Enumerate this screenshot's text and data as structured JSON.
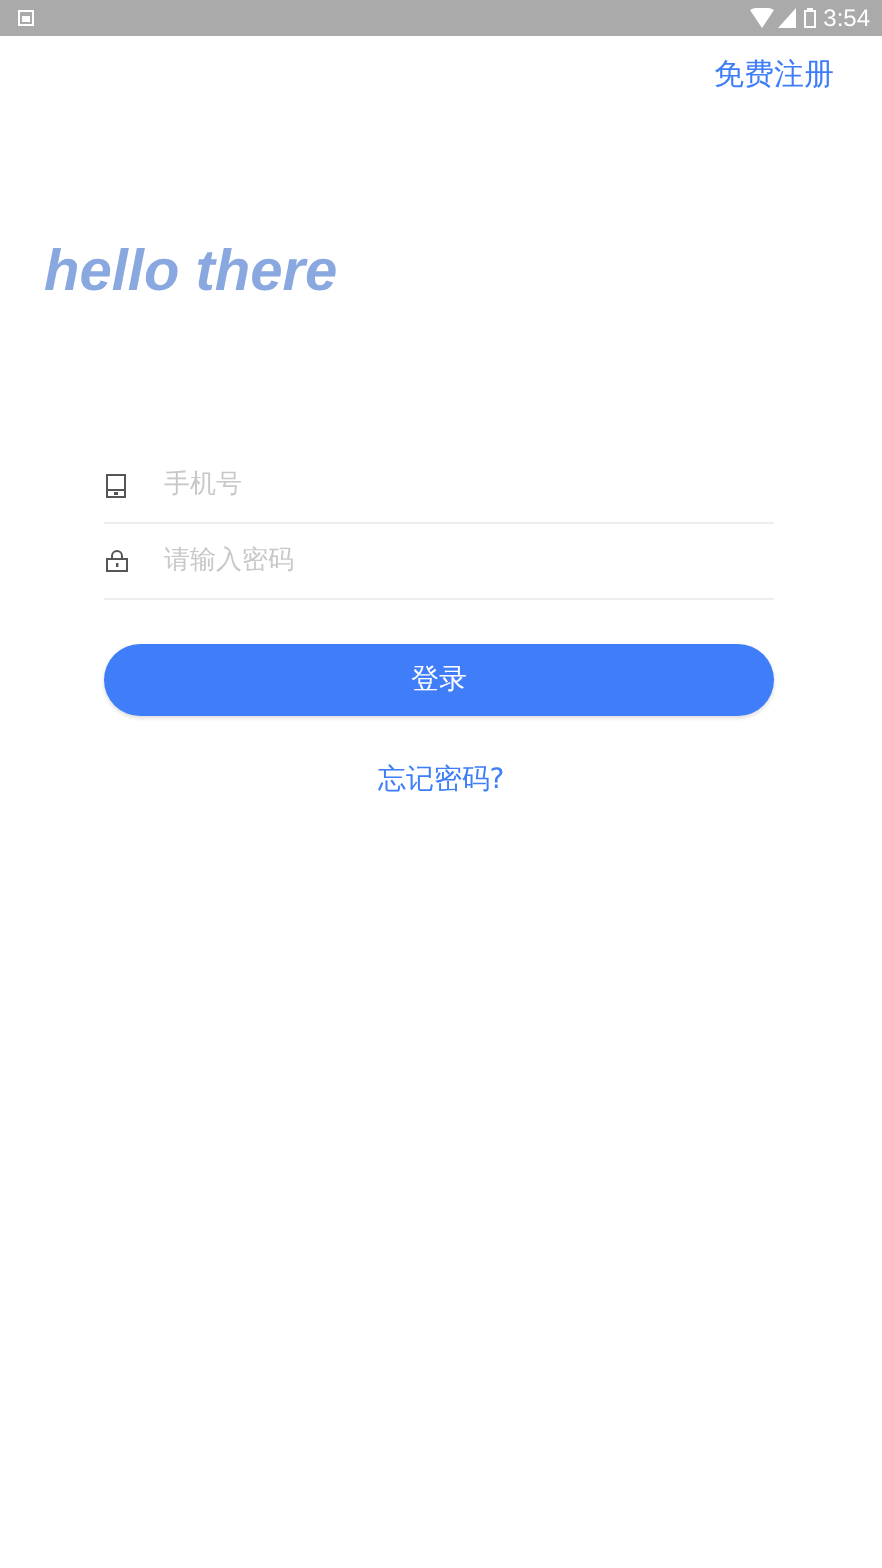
{
  "status_bar": {
    "time": "3:54"
  },
  "register_link": "免费注册",
  "greeting": "hello there",
  "fields": [
    {
      "kind": "phone",
      "placeholder": "手机号"
    },
    {
      "kind": "password",
      "placeholder": "请输入密码"
    }
  ],
  "login_button": "登录",
  "forgot_link": "忘记密码?"
}
